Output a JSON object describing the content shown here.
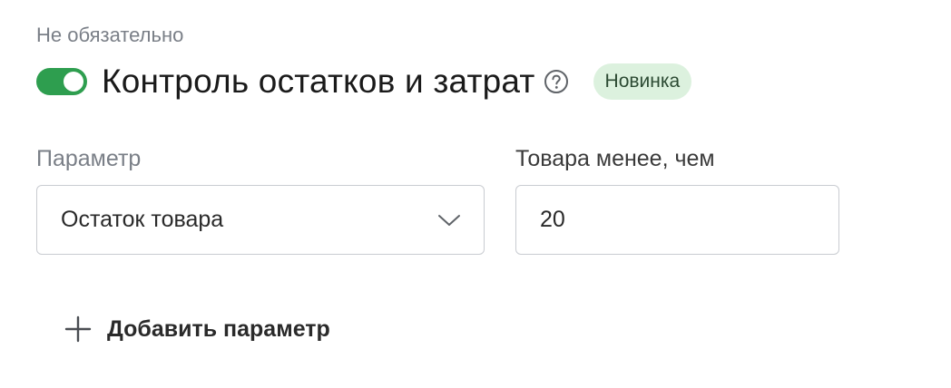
{
  "section": {
    "optional_label": "Не обязательно",
    "title": "Контроль остатков и затрат",
    "badge": "Новинка",
    "toggle_on": true,
    "help_icon": "question-circle-icon",
    "accent_color": "#2e9e4f",
    "badge_bg": "#dcf1de"
  },
  "form": {
    "parameter_label": "Параметр",
    "parameter_value": "Остаток товара",
    "threshold_label": "Товара менее, чем",
    "threshold_value": "20",
    "dropdown_icon": "chevron-down-icon"
  },
  "actions": {
    "add_parameter_label": "Добавить параметр",
    "add_icon": "plus-icon"
  }
}
